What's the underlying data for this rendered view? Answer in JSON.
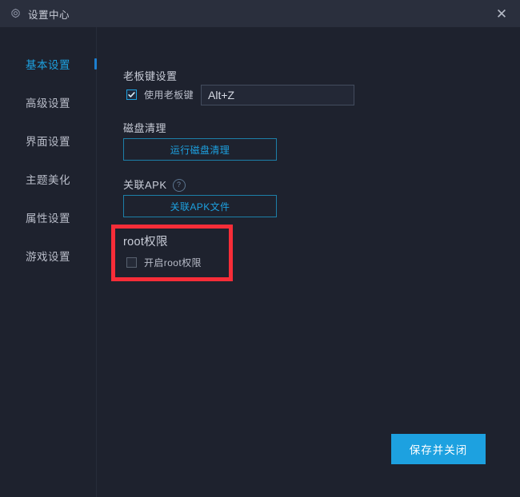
{
  "window": {
    "title": "设置中心",
    "icon": "gear-icon",
    "close_label": "✕",
    "background": "#1e222e",
    "titlebar_background": "#2a2f3d",
    "accent": "#1da1e0",
    "highlight_color": "#f72d38"
  },
  "sidebar": {
    "items": [
      {
        "label": "基本设置",
        "active": true
      },
      {
        "label": "高级设置",
        "active": false
      },
      {
        "label": "界面设置",
        "active": false
      },
      {
        "label": "主题美化",
        "active": false
      },
      {
        "label": "属性设置",
        "active": false
      },
      {
        "label": "游戏设置",
        "active": false
      }
    ]
  },
  "main": {
    "boss_key": {
      "section_title": "老板键设置",
      "checkbox_label": "使用老板键",
      "checked": true,
      "hotkey_value": "Alt+Z",
      "hotkey_placeholder": "Alt+Z"
    },
    "disk_clean": {
      "section_title": "磁盘清理",
      "button_label": "运行磁盘清理"
    },
    "apk": {
      "section_title": "关联APK",
      "help_icon_label": "?",
      "button_label": "关联APK文件"
    },
    "root": {
      "section_title": "root权限",
      "checkbox_label": "开启root权限",
      "checked": false
    },
    "footer": {
      "save_label": "保存并关闭"
    }
  }
}
